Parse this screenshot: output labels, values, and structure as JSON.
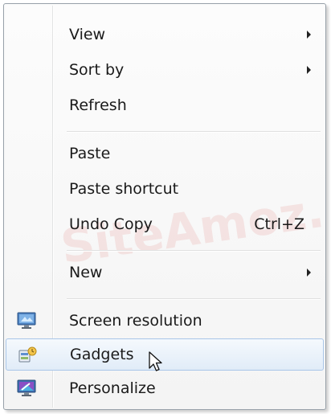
{
  "context_menu": {
    "items": [
      {
        "label": "View",
        "icon": "",
        "shortcut": "",
        "submenu": true
      },
      {
        "label": "Sort by",
        "icon": "",
        "shortcut": "",
        "submenu": true
      },
      {
        "label": "Refresh",
        "icon": "",
        "shortcut": "",
        "submenu": false
      },
      {
        "label": "Paste",
        "icon": "",
        "shortcut": "",
        "submenu": false
      },
      {
        "label": "Paste shortcut",
        "icon": "",
        "shortcut": "",
        "submenu": false
      },
      {
        "label": "Undo Copy",
        "icon": "",
        "shortcut": "Ctrl+Z",
        "submenu": false
      },
      {
        "label": "New",
        "icon": "",
        "shortcut": "",
        "submenu": true
      },
      {
        "label": "Screen resolution",
        "icon": "screen-resolution-icon",
        "shortcut": "",
        "submenu": false
      },
      {
        "label": "Gadgets",
        "icon": "gadgets-icon",
        "shortcut": "",
        "submenu": false,
        "highlighted": true
      },
      {
        "label": "Personalize",
        "icon": "personalize-icon",
        "shortcut": "",
        "submenu": false
      }
    ]
  },
  "watermark_text": "SiteAmoz.ir",
  "colors": {
    "menu_background": "#f4f4f4",
    "hover_background": "#e1ecf8",
    "hover_border": "#a9c6e8",
    "text": "#1a1a1a",
    "watermark": "#d9534f"
  }
}
